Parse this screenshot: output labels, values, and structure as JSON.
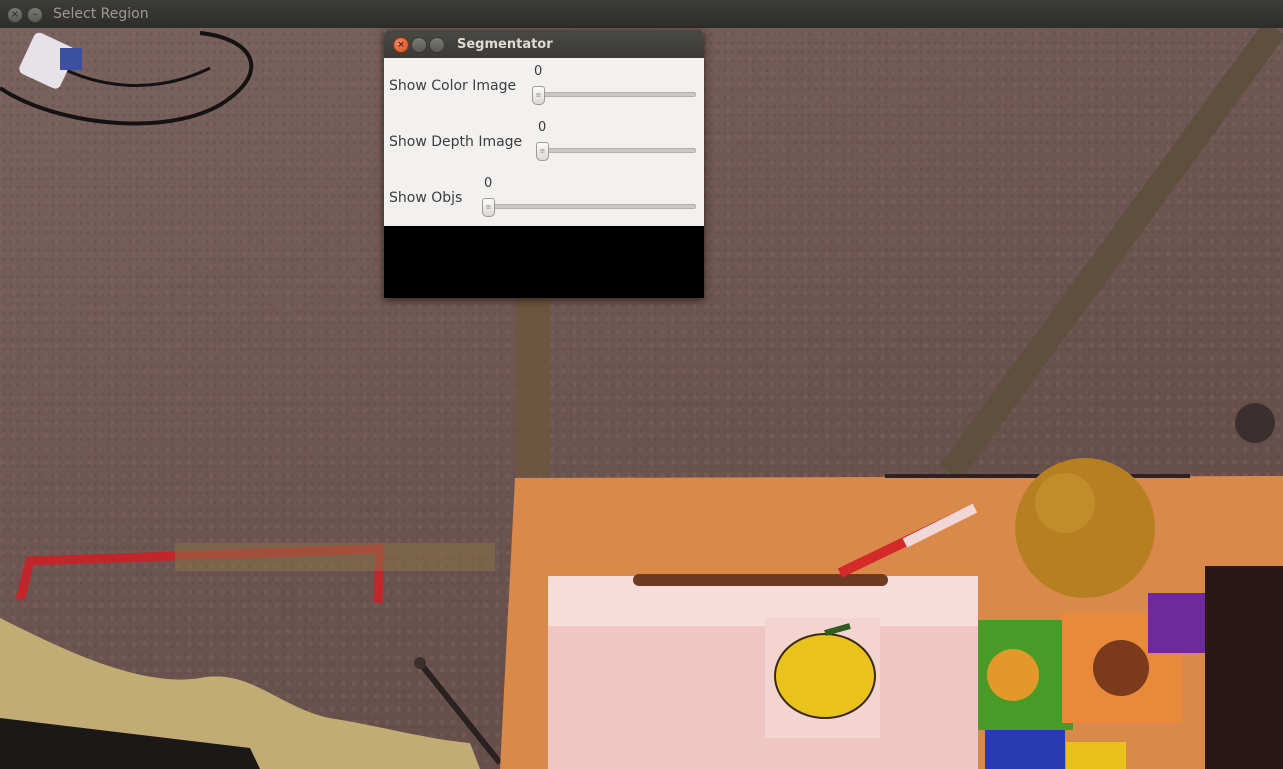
{
  "main_window": {
    "title": "Select Region",
    "close_glyph": "×",
    "minimize_glyph": "–"
  },
  "segmentator": {
    "title": "Segmentator",
    "close_glyph": "×",
    "trackbars": [
      {
        "label": "Show Color Image",
        "value": "0"
      },
      {
        "label": "Show Depth Image",
        "value": "0"
      },
      {
        "label": "Show Objs",
        "value": "0"
      }
    ]
  }
}
